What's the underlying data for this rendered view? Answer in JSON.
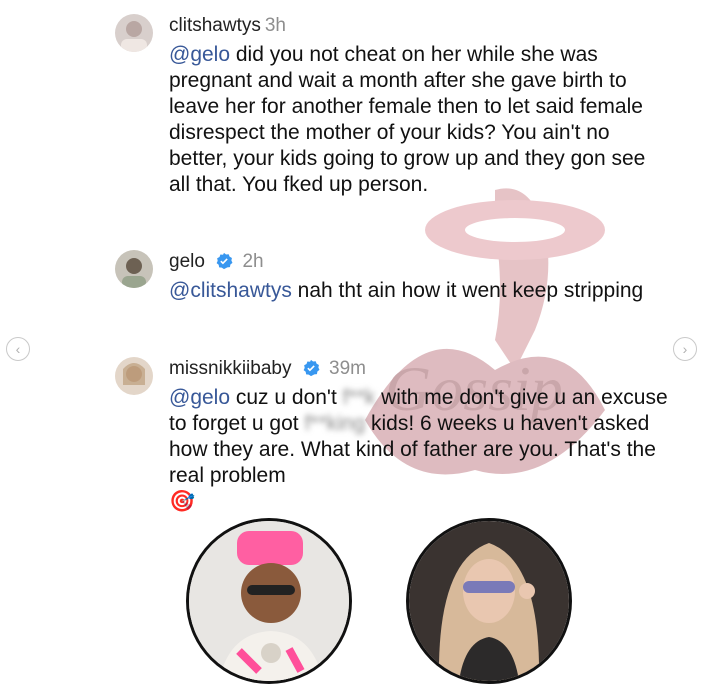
{
  "comments": [
    {
      "username": "clitshawtys",
      "time": "3h",
      "verified": false,
      "mention": "@gelo",
      "text": " did you not cheat on her while she was pregnant and wait a month after she gave birth to leave her for another female then to let said female disrespect the mother of your kids? You ain't no better, your kids going to grow up and they gon see all that. You fked up person."
    },
    {
      "username": "gelo",
      "time": "2h",
      "verified": true,
      "mention": "@clitshawtys",
      "text": " nah tht ain how it went keep stripping"
    },
    {
      "username": "missnikkiibaby",
      "time": "39m",
      "verified": true,
      "mention": "@gelo",
      "text_parts": [
        " cuz u don't ",
        "f**k",
        " with me don't give u an excuse to forget u got ",
        "f**king",
        " kids! 6 weeks u haven't asked how they are. What kind of father are you. That's the real problem "
      ],
      "emoji": "🎯"
    }
  ],
  "nav": {
    "prev_icon": "chevron-left-icon",
    "next_icon": "chevron-right-icon"
  },
  "colors": {
    "mention": "#385898",
    "verified": "#3897f0",
    "time": "#8e8e8e"
  }
}
